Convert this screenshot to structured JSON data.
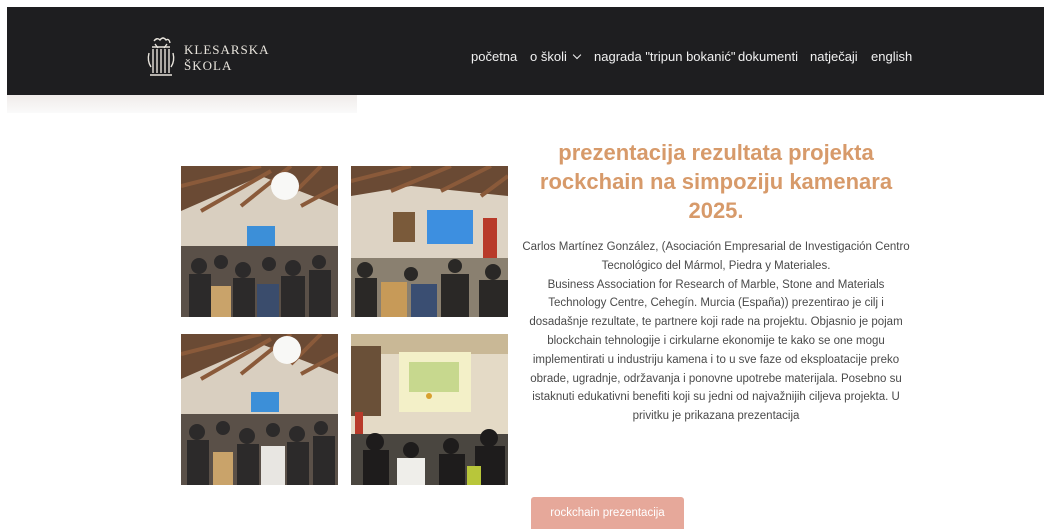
{
  "header": {
    "logo_line1": "KLESARSKA",
    "logo_line2": "ŠKOLA",
    "nav": {
      "pocetna": "početna",
      "o_skoli": "o školi",
      "nagrada": "nagrada \"tripun bokanić\"",
      "dokumenti": "dokumenti",
      "natjecaji": "natječaji",
      "english": "english"
    }
  },
  "article": {
    "title_lines": [
      "prezentacija rezultata projekta",
      "rockchain na simpoziju kamenara",
      "2025."
    ],
    "body_lines": [
      "Carlos Martínez González, (Asociación Empresarial de Investigación Centro",
      "Tecnológico del Mármol, Piedra y Materiales.",
      "Business Association for Research of Marble, Stone and Materials",
      "Technology Centre, Cehegín. Murcia (España)) prezentirao je cilj i",
      "dosadašnje rezultate, te partnere koji rade na projektu. Objasnio je pojam",
      "blockchain tehnologije i cirkularne ekonomije te kako se one mogu",
      "implementirati u industriju kamena i to u sve faze od eksploatacije preko",
      "obrade, ugradnje, održavanja i ponovne upotrebe materijala. Posebno su",
      "istaknuti edukativni benefiti koji su jedni od najvažnijih ciljeva projekta. U",
      "privitku je prikazana prezentacija"
    ],
    "button_label": "rockchain prezentacija"
  },
  "colors": {
    "header_bg": "#1e1e20",
    "title": "#d79a6a",
    "button_bg": "#e6a89a"
  }
}
